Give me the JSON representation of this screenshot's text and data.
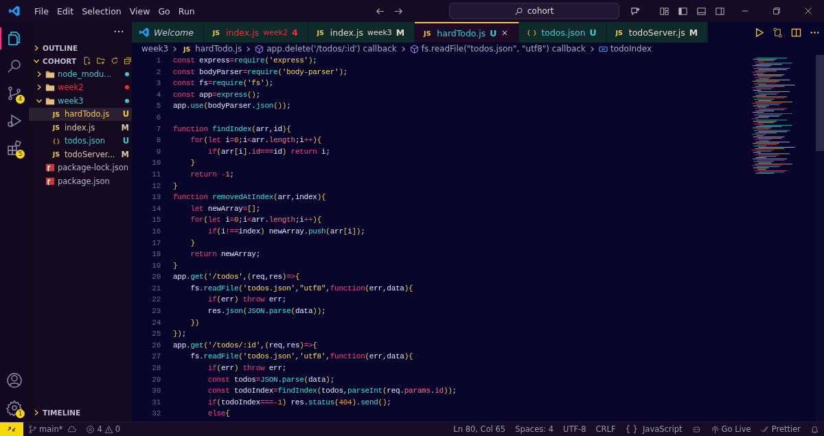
{
  "title_bar": {
    "menu": [
      "File",
      "Edit",
      "Selection",
      "View",
      "Go",
      "Run"
    ],
    "search": {
      "value": "cohort"
    }
  },
  "activity_bar": {
    "items": [
      {
        "kind": "explorer",
        "selected": true
      },
      {
        "kind": "search",
        "selected": false
      },
      {
        "kind": "source-control",
        "selected": false,
        "badge": "4"
      },
      {
        "kind": "run",
        "selected": false
      },
      {
        "kind": "extensions",
        "selected": false,
        "badge": "5"
      }
    ],
    "bottom": [
      {
        "kind": "account",
        "selected": false
      },
      {
        "kind": "settings",
        "selected": false,
        "badge": "1"
      }
    ]
  },
  "sidebar": {
    "outline": {
      "label": "OUTLINE",
      "expanded": false
    },
    "folder": {
      "label": "COHORT",
      "expanded": true
    },
    "tree": [
      {
        "kind": "folder",
        "name": "node_modu...",
        "color": "#3fc8d0",
        "dot": true,
        "expanded": false,
        "selected": false
      },
      {
        "kind": "folder",
        "name": "week2",
        "color": "#ff2a3a",
        "dot": true,
        "expanded": false,
        "selected": false
      },
      {
        "kind": "folder",
        "name": "week3",
        "color": "#3fc8d0",
        "dot": true,
        "expanded": true,
        "selected": false,
        "children": [
          {
            "kind": "js",
            "icon": "JS",
            "name": "hardTodo.js",
            "status": "U",
            "color": "#f5c542",
            "selected": true
          },
          {
            "kind": "js",
            "icon": "JS",
            "name": "index.js",
            "status": "M",
            "color": "#d6c8a8",
            "selected": false
          },
          {
            "kind": "json",
            "icon": "{}",
            "name": "todos.json",
            "status": "U",
            "color": "#3fc8d0",
            "selected": false
          },
          {
            "kind": "js",
            "icon": "JS",
            "name": "todoServer...",
            "status": "M",
            "color": "#d6c8a8",
            "selected": false
          }
        ]
      },
      {
        "kind": "npm",
        "name": "package-lock.json",
        "color": "#b8b8c8",
        "selected": false
      },
      {
        "kind": "npm",
        "name": "package.json",
        "color": "#b8b8c8",
        "selected": false
      }
    ],
    "timeline": {
      "label": "TIMELINE",
      "expanded": false
    }
  },
  "tabs": [
    {
      "kind": "welcome",
      "label": "Welcome",
      "color": "#c8c8d8",
      "italic": true,
      "selected": false
    },
    {
      "kind": "js",
      "icon": "JS",
      "label": "index.js",
      "detail": "week2",
      "badge": "4",
      "color": "#ff2a3a",
      "italic": false,
      "selected": false
    },
    {
      "kind": "js",
      "icon": "JS",
      "label": "index.js",
      "detail": "week3",
      "badge": "M",
      "color": "#e0d8c0",
      "italic": false,
      "selected": false
    },
    {
      "kind": "js",
      "icon": "JS",
      "label": "hardTodo.js",
      "badge": "U",
      "color": "#3fc8d0",
      "italic": false,
      "selected": true
    },
    {
      "kind": "json",
      "icon": "{ }",
      "label": "todos.json",
      "badge": "U",
      "color": "#3fc8d0",
      "italic": false,
      "selected": false
    },
    {
      "kind": "js",
      "icon": "JS",
      "label": "todoServer.js",
      "badge": "M",
      "color": "#e0d8c0",
      "italic": false,
      "selected": false
    }
  ],
  "breadcrumb": [
    {
      "kind": "folder",
      "label": "week3"
    },
    {
      "kind": "js",
      "icon": "JS",
      "label": "hardTodo.js"
    },
    {
      "kind": "method",
      "label": "app.delete('/todos/:id') callback"
    },
    {
      "kind": "method",
      "label": "fs.readFile(\"todos.json\", \"utf8\") callback"
    },
    {
      "kind": "variable",
      "label": "todoIndex"
    }
  ],
  "editor": {
    "lines": [
      {
        "n": "1",
        "tokens": [
          {
            "kind": "k",
            "text": "const "
          },
          {
            "kind": "v",
            "text": "express"
          },
          {
            "kind": "o",
            "text": "="
          },
          {
            "kind": "f",
            "text": "require"
          },
          {
            "kind": "b",
            "text": "("
          },
          {
            "kind": "s",
            "text": "'express'"
          },
          {
            "kind": "b",
            "text": ")"
          },
          {
            "kind": "p",
            "text": ";"
          }
        ]
      },
      {
        "n": "2",
        "tokens": [
          {
            "kind": "k",
            "text": "const "
          },
          {
            "kind": "v",
            "text": "bodyParser"
          },
          {
            "kind": "o",
            "text": "="
          },
          {
            "kind": "f",
            "text": "require"
          },
          {
            "kind": "b",
            "text": "("
          },
          {
            "kind": "s",
            "text": "'body-parser'"
          },
          {
            "kind": "b",
            "text": ")"
          },
          {
            "kind": "p",
            "text": ";"
          }
        ]
      },
      {
        "n": "3",
        "tokens": [
          {
            "kind": "k",
            "text": "const "
          },
          {
            "kind": "v",
            "text": "fs"
          },
          {
            "kind": "o",
            "text": "="
          },
          {
            "kind": "f",
            "text": "require"
          },
          {
            "kind": "b",
            "text": "("
          },
          {
            "kind": "s",
            "text": "'fs'"
          },
          {
            "kind": "b",
            "text": ")"
          },
          {
            "kind": "p",
            "text": ";"
          }
        ]
      },
      {
        "n": "4",
        "tokens": [
          {
            "kind": "k",
            "text": "const "
          },
          {
            "kind": "v",
            "text": "app"
          },
          {
            "kind": "o",
            "text": "="
          },
          {
            "kind": "f",
            "text": "express"
          },
          {
            "kind": "b",
            "text": "()"
          },
          {
            "kind": "p",
            "text": ";"
          }
        ]
      },
      {
        "n": "5",
        "tokens": [
          {
            "kind": "v",
            "text": "app"
          },
          {
            "kind": "p",
            "text": "."
          },
          {
            "kind": "f",
            "text": "use"
          },
          {
            "kind": "b",
            "text": "("
          },
          {
            "kind": "v",
            "text": "bodyParser"
          },
          {
            "kind": "p",
            "text": "."
          },
          {
            "kind": "f",
            "text": "json"
          },
          {
            "kind": "b",
            "text": "())"
          },
          {
            "kind": "p",
            "text": ";"
          }
        ]
      },
      {
        "n": "6"
      },
      {
        "n": "7",
        "tokens": [
          {
            "kind": "k",
            "text": "function "
          },
          {
            "kind": "f",
            "text": "findIndex"
          },
          {
            "kind": "b",
            "text": "("
          },
          {
            "kind": "v",
            "text": "arr"
          },
          {
            "kind": "p",
            "text": ","
          },
          {
            "kind": "v",
            "text": "id"
          },
          {
            "kind": "b",
            "text": "){"
          }
        ]
      },
      {
        "n": "8",
        "tokens": [
          {
            "kind": "k",
            "text": "    for"
          },
          {
            "kind": "b",
            "text": "("
          },
          {
            "kind": "k",
            "text": "let "
          },
          {
            "kind": "v",
            "text": "i"
          },
          {
            "kind": "o",
            "text": "="
          },
          {
            "kind": "n",
            "text": "0"
          },
          {
            "kind": "p",
            "text": ";"
          },
          {
            "kind": "v",
            "text": "i"
          },
          {
            "kind": "o",
            "text": "<"
          },
          {
            "kind": "v",
            "text": "arr"
          },
          {
            "kind": "p",
            "text": "."
          },
          {
            "kind": "m",
            "text": "length"
          },
          {
            "kind": "p",
            "text": ";"
          },
          {
            "kind": "v",
            "text": "i"
          },
          {
            "kind": "o",
            "text": "++"
          },
          {
            "kind": "b",
            "text": "){"
          }
        ]
      },
      {
        "n": "9",
        "tokens": [
          {
            "kind": "k",
            "text": "        if"
          },
          {
            "kind": "b",
            "text": "("
          },
          {
            "kind": "v",
            "text": "arr"
          },
          {
            "kind": "b",
            "text": "["
          },
          {
            "kind": "v",
            "text": "i"
          },
          {
            "kind": "b",
            "text": "]"
          },
          {
            "kind": "p",
            "text": "."
          },
          {
            "kind": "m",
            "text": "id"
          },
          {
            "kind": "o",
            "text": "==="
          },
          {
            "kind": "v",
            "text": "id"
          },
          {
            "kind": "b",
            "text": ")"
          },
          {
            "kind": "k",
            "text": " return "
          },
          {
            "kind": "v",
            "text": "i"
          },
          {
            "kind": "p",
            "text": ";"
          }
        ]
      },
      {
        "n": "10",
        "tokens": [
          {
            "kind": "b",
            "text": "    }"
          }
        ]
      },
      {
        "n": "11",
        "tokens": [
          {
            "kind": "k",
            "text": "    return "
          },
          {
            "kind": "o",
            "text": "-"
          },
          {
            "kind": "n",
            "text": "1"
          },
          {
            "kind": "p",
            "text": ";"
          }
        ]
      },
      {
        "n": "12",
        "tokens": [
          {
            "kind": "b",
            "text": "}"
          }
        ]
      },
      {
        "n": "13",
        "tokens": [
          {
            "kind": "k",
            "text": "function "
          },
          {
            "kind": "f",
            "text": "removedAtIndex"
          },
          {
            "kind": "b",
            "text": "("
          },
          {
            "kind": "v",
            "text": "arr"
          },
          {
            "kind": "p",
            "text": ","
          },
          {
            "kind": "v",
            "text": "index"
          },
          {
            "kind": "b",
            "text": "){"
          }
        ]
      },
      {
        "n": "14",
        "tokens": [
          {
            "kind": "k",
            "text": "    let "
          },
          {
            "kind": "v",
            "text": "newArray"
          },
          {
            "kind": "o",
            "text": "="
          },
          {
            "kind": "b",
            "text": "[]"
          },
          {
            "kind": "p",
            "text": ";"
          }
        ]
      },
      {
        "n": "15",
        "tokens": [
          {
            "kind": "k",
            "text": "    for"
          },
          {
            "kind": "b",
            "text": "("
          },
          {
            "kind": "k",
            "text": "let "
          },
          {
            "kind": "v",
            "text": "i"
          },
          {
            "kind": "o",
            "text": "="
          },
          {
            "kind": "n",
            "text": "0"
          },
          {
            "kind": "p",
            "text": ";"
          },
          {
            "kind": "v",
            "text": "i"
          },
          {
            "kind": "o",
            "text": "<"
          },
          {
            "kind": "v",
            "text": "arr"
          },
          {
            "kind": "p",
            "text": "."
          },
          {
            "kind": "m",
            "text": "length"
          },
          {
            "kind": "p",
            "text": ";"
          },
          {
            "kind": "v",
            "text": "i"
          },
          {
            "kind": "o",
            "text": "++"
          },
          {
            "kind": "b",
            "text": "){"
          }
        ]
      },
      {
        "n": "16",
        "tokens": [
          {
            "kind": "k",
            "text": "        if"
          },
          {
            "kind": "b",
            "text": "("
          },
          {
            "kind": "v",
            "text": "i"
          },
          {
            "kind": "o",
            "text": "!=="
          },
          {
            "kind": "v",
            "text": "index"
          },
          {
            "kind": "b",
            "text": ")"
          },
          {
            "kind": "v",
            "text": " newArray"
          },
          {
            "kind": "p",
            "text": "."
          },
          {
            "kind": "f",
            "text": "push"
          },
          {
            "kind": "b",
            "text": "("
          },
          {
            "kind": "v",
            "text": "arr"
          },
          {
            "kind": "b",
            "text": "["
          },
          {
            "kind": "v",
            "text": "i"
          },
          {
            "kind": "b",
            "text": "])"
          },
          {
            "kind": "p",
            "text": ";"
          }
        ]
      },
      {
        "n": "17",
        "tokens": [
          {
            "kind": "b",
            "text": "    }"
          }
        ]
      },
      {
        "n": "18",
        "tokens": [
          {
            "kind": "k",
            "text": "    return "
          },
          {
            "kind": "v",
            "text": "newArray"
          },
          {
            "kind": "p",
            "text": ";"
          }
        ]
      },
      {
        "n": "19",
        "tokens": [
          {
            "kind": "b",
            "text": "}"
          }
        ]
      },
      {
        "n": "20",
        "tokens": [
          {
            "kind": "v",
            "text": "app"
          },
          {
            "kind": "p",
            "text": "."
          },
          {
            "kind": "f",
            "text": "get"
          },
          {
            "kind": "b",
            "text": "("
          },
          {
            "kind": "s",
            "text": "'/todos'"
          },
          {
            "kind": "p",
            "text": ","
          },
          {
            "kind": "b",
            "text": "("
          },
          {
            "kind": "v",
            "text": "req"
          },
          {
            "kind": "p",
            "text": ","
          },
          {
            "kind": "v",
            "text": "res"
          },
          {
            "kind": "b",
            "text": ")"
          },
          {
            "kind": "o",
            "text": "=>"
          },
          {
            "kind": "b",
            "text": "{"
          }
        ]
      },
      {
        "n": "21",
        "tokens": [
          {
            "kind": "v",
            "text": "    fs"
          },
          {
            "kind": "p",
            "text": "."
          },
          {
            "kind": "f",
            "text": "readFile"
          },
          {
            "kind": "b",
            "text": "("
          },
          {
            "kind": "s",
            "text": "'todos.json'"
          },
          {
            "kind": "p",
            "text": ","
          },
          {
            "kind": "s",
            "text": "\"utf8\""
          },
          {
            "kind": "p",
            "text": ","
          },
          {
            "kind": "k",
            "text": "function"
          },
          {
            "kind": "b",
            "text": "("
          },
          {
            "kind": "v",
            "text": "err"
          },
          {
            "kind": "p",
            "text": ","
          },
          {
            "kind": "v",
            "text": "data"
          },
          {
            "kind": "b",
            "text": "){"
          }
        ]
      },
      {
        "n": "22",
        "tokens": [
          {
            "kind": "k",
            "text": "        if"
          },
          {
            "kind": "b",
            "text": "("
          },
          {
            "kind": "v",
            "text": "err"
          },
          {
            "kind": "b",
            "text": ")"
          },
          {
            "kind": "k",
            "text": " throw "
          },
          {
            "kind": "v",
            "text": "err"
          },
          {
            "kind": "p",
            "text": ";"
          }
        ]
      },
      {
        "n": "23",
        "tokens": [
          {
            "kind": "v",
            "text": "        res"
          },
          {
            "kind": "p",
            "text": "."
          },
          {
            "kind": "f",
            "text": "json"
          },
          {
            "kind": "b",
            "text": "("
          },
          {
            "kind": "f",
            "text": "JSON"
          },
          {
            "kind": "p",
            "text": "."
          },
          {
            "kind": "f",
            "text": "parse"
          },
          {
            "kind": "b",
            "text": "("
          },
          {
            "kind": "v",
            "text": "data"
          },
          {
            "kind": "b",
            "text": "))"
          },
          {
            "kind": "p",
            "text": ";"
          }
        ]
      },
      {
        "n": "24",
        "tokens": [
          {
            "kind": "b",
            "text": "    })"
          }
        ]
      },
      {
        "n": "25",
        "tokens": [
          {
            "kind": "b",
            "text": "})"
          },
          {
            "kind": "p",
            "text": ";"
          }
        ]
      },
      {
        "n": "26",
        "tokens": [
          {
            "kind": "v",
            "text": "app"
          },
          {
            "kind": "p",
            "text": "."
          },
          {
            "kind": "f",
            "text": "get"
          },
          {
            "kind": "b",
            "text": "("
          },
          {
            "kind": "s",
            "text": "'/todos/:id'"
          },
          {
            "kind": "p",
            "text": ","
          },
          {
            "kind": "b",
            "text": "("
          },
          {
            "kind": "v",
            "text": "req"
          },
          {
            "kind": "p",
            "text": ","
          },
          {
            "kind": "v",
            "text": "res"
          },
          {
            "kind": "b",
            "text": ")"
          },
          {
            "kind": "o",
            "text": "=>"
          },
          {
            "kind": "b",
            "text": "{"
          }
        ]
      },
      {
        "n": "27",
        "tokens": [
          {
            "kind": "v",
            "text": "    fs"
          },
          {
            "kind": "p",
            "text": "."
          },
          {
            "kind": "f",
            "text": "readFile"
          },
          {
            "kind": "b",
            "text": "("
          },
          {
            "kind": "s",
            "text": "'todos.json'"
          },
          {
            "kind": "p",
            "text": ","
          },
          {
            "kind": "s",
            "text": "'utf8'"
          },
          {
            "kind": "p",
            "text": ","
          },
          {
            "kind": "k",
            "text": "function"
          },
          {
            "kind": "b",
            "text": "("
          },
          {
            "kind": "v",
            "text": "err"
          },
          {
            "kind": "p",
            "text": ","
          },
          {
            "kind": "v",
            "text": "data"
          },
          {
            "kind": "b",
            "text": "){"
          }
        ]
      },
      {
        "n": "28",
        "tokens": [
          {
            "kind": "k",
            "text": "        if"
          },
          {
            "kind": "b",
            "text": "("
          },
          {
            "kind": "v",
            "text": "err"
          },
          {
            "kind": "b",
            "text": ")"
          },
          {
            "kind": "k",
            "text": " throw "
          },
          {
            "kind": "v",
            "text": "err"
          },
          {
            "kind": "p",
            "text": ";"
          }
        ]
      },
      {
        "n": "29",
        "tokens": [
          {
            "kind": "k",
            "text": "        const "
          },
          {
            "kind": "v",
            "text": "todos"
          },
          {
            "kind": "o",
            "text": "="
          },
          {
            "kind": "f",
            "text": "JSON"
          },
          {
            "kind": "p",
            "text": "."
          },
          {
            "kind": "f",
            "text": "parse"
          },
          {
            "kind": "b",
            "text": "("
          },
          {
            "kind": "v",
            "text": "data"
          },
          {
            "kind": "b",
            "text": ")"
          },
          {
            "kind": "p",
            "text": ";"
          }
        ]
      },
      {
        "n": "30",
        "tokens": [
          {
            "kind": "k",
            "text": "        const "
          },
          {
            "kind": "v",
            "text": "todoIndex"
          },
          {
            "kind": "o",
            "text": "="
          },
          {
            "kind": "f",
            "text": "findIndex"
          },
          {
            "kind": "b",
            "text": "("
          },
          {
            "kind": "v",
            "text": "todos"
          },
          {
            "kind": "p",
            "text": ","
          },
          {
            "kind": "f",
            "text": "parseInt"
          },
          {
            "kind": "b",
            "text": "("
          },
          {
            "kind": "v",
            "text": "req"
          },
          {
            "kind": "p",
            "text": "."
          },
          {
            "kind": "m",
            "text": "params"
          },
          {
            "kind": "p",
            "text": "."
          },
          {
            "kind": "m",
            "text": "id"
          },
          {
            "kind": "b",
            "text": "))"
          },
          {
            "kind": "p",
            "text": ";"
          }
        ]
      },
      {
        "n": "31",
        "tokens": [
          {
            "kind": "k",
            "text": "        if"
          },
          {
            "kind": "b",
            "text": "("
          },
          {
            "kind": "v",
            "text": "todoIndex"
          },
          {
            "kind": "o",
            "text": "===-"
          },
          {
            "kind": "n",
            "text": "1"
          },
          {
            "kind": "b",
            "text": ")"
          },
          {
            "kind": "v",
            "text": " res"
          },
          {
            "kind": "p",
            "text": "."
          },
          {
            "kind": "f",
            "text": "status"
          },
          {
            "kind": "b",
            "text": "("
          },
          {
            "kind": "n",
            "text": "404"
          },
          {
            "kind": "b",
            "text": ")"
          },
          {
            "kind": "p",
            "text": "."
          },
          {
            "kind": "f",
            "text": "send"
          },
          {
            "kind": "b",
            "text": "()"
          },
          {
            "kind": "p",
            "text": ";"
          }
        ]
      },
      {
        "n": "32",
        "tokens": [
          {
            "kind": "k",
            "text": "        else"
          },
          {
            "kind": "b",
            "text": "{"
          }
        ]
      }
    ]
  },
  "status_bar": {
    "branch": "main*",
    "errors": "4",
    "warnings": "0",
    "right": [
      {
        "kind": "text",
        "label": "Ln 80, Col 65"
      },
      {
        "kind": "text",
        "label": "Spaces: 4"
      },
      {
        "kind": "text",
        "label": "UTF-8"
      },
      {
        "kind": "text",
        "label": "CRLF"
      },
      {
        "kind": "language",
        "icon": "{ }",
        "label": "JavaScript"
      },
      {
        "kind": "copilot"
      },
      {
        "kind": "golive",
        "label": "Go Live"
      },
      {
        "kind": "prettier",
        "label": "Prettier"
      },
      {
        "kind": "bell"
      }
    ]
  }
}
